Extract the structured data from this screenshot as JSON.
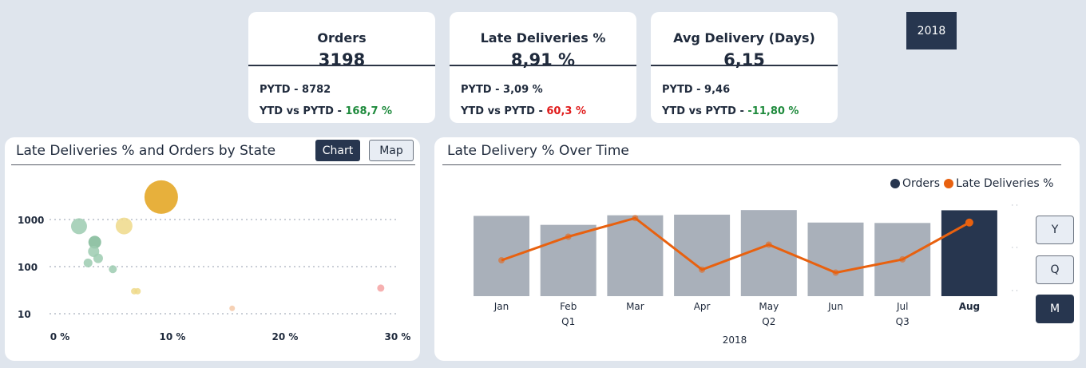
{
  "kpis": [
    {
      "title": "Orders",
      "value": "3198",
      "pytd": "PYTD - 8782",
      "cmp_label": "YTD vs PYTD - ",
      "cmp_value": "168,7 %"
    },
    {
      "title": "Late Deliveries %",
      "value": "8,91 %",
      "pytd": "PYTD - 3,09 %",
      "cmp_label": "YTD vs PYTD - ",
      "cmp_value": "60,3 %"
    },
    {
      "title": "Avg Delivery (Days)",
      "value": "6,15",
      "pytd": "PYTD - 9,46",
      "cmp_label": "YTD vs PYTD - ",
      "cmp_value": "-11,80 %"
    }
  ],
  "year_slicer": {
    "label": "2018"
  },
  "scatter_card": {
    "title": "Late Deliveries % and Orders by State",
    "toggle_chart": "Chart",
    "toggle_map": "Map"
  },
  "combo_card": {
    "title": "Late Delivery % Over Time",
    "legend": [
      {
        "label": "Orders",
        "color": "#27364f"
      },
      {
        "label": "Late Deliveries %",
        "color": "#e8610f"
      }
    ],
    "level_buttons": [
      "Y",
      "Q",
      "M"
    ],
    "selected_level": "M"
  },
  "colors": {
    "bar": "#a9b0ba",
    "bar_selected": "#27364f",
    "line": "#e8610f",
    "positive": "#1e8a3c",
    "negative": "#e01b1b"
  },
  "chart_data": [
    {
      "type": "scatter",
      "title": "Late Deliveries % and Orders by State",
      "x_ticks": [
        "0 %",
        "10 %",
        "20 %",
        "30 %"
      ],
      "xlim": [
        0,
        30
      ],
      "y_ticks": [
        "10",
        "100",
        "1000"
      ],
      "y_scale": "log",
      "ylim": [
        5,
        5000
      ],
      "grid": true,
      "points": [
        {
          "x": 9.0,
          "y": 3000,
          "size": 40,
          "color": "#e3a21a"
        },
        {
          "x": 1.7,
          "y": 720,
          "size": 18,
          "color": "#9ccbb0"
        },
        {
          "x": 5.7,
          "y": 730,
          "size": 19,
          "color": "#efd98a"
        },
        {
          "x": 3.1,
          "y": 330,
          "size": 14,
          "color": "#7fb997"
        },
        {
          "x": 3.0,
          "y": 210,
          "size": 12,
          "color": "#9ccbb0"
        },
        {
          "x": 3.4,
          "y": 150,
          "size": 10,
          "color": "#9ccbb0"
        },
        {
          "x": 2.5,
          "y": 120,
          "size": 9,
          "color": "#9ccbb0"
        },
        {
          "x": 4.7,
          "y": 88,
          "size": 8,
          "color": "#9ccbb0"
        },
        {
          "x": 6.6,
          "y": 30,
          "size": 6,
          "color": "#efd98a"
        },
        {
          "x": 6.9,
          "y": 30,
          "size": 6,
          "color": "#efd98a"
        },
        {
          "x": 15.3,
          "y": 13,
          "size": 5,
          "color": "#f4c9a8"
        },
        {
          "x": 28.5,
          "y": 35,
          "size": 7,
          "color": "#f4a2a2"
        }
      ]
    },
    {
      "type": "bar",
      "title": "Late Delivery % Over Time",
      "categories": [
        "Jan",
        "Feb",
        "Mar",
        "Apr",
        "May",
        "Jun",
        "Jul",
        "Aug"
      ],
      "quarters": [
        {
          "label": "Q1",
          "after": "Feb"
        },
        {
          "label": "Q2",
          "after": "May"
        },
        {
          "label": "Q3",
          "after": "Jul"
        }
      ],
      "year_label": "2018",
      "selected": "Aug",
      "series": [
        {
          "name": "Orders",
          "type": "bar",
          "values": [
            386,
            343,
            389,
            392,
            414,
            354,
            352,
            413
          ]
        },
        {
          "name": "Late Deliveries %",
          "type": "line",
          "values": [
            1.2,
            9.2,
            15.5,
            -2.0,
            6.5,
            -3.0,
            1.5,
            14.0
          ]
        }
      ],
      "bars_ylim": [
        0,
        430
      ],
      "line_ylim": [
        -8,
        18
      ]
    }
  ]
}
